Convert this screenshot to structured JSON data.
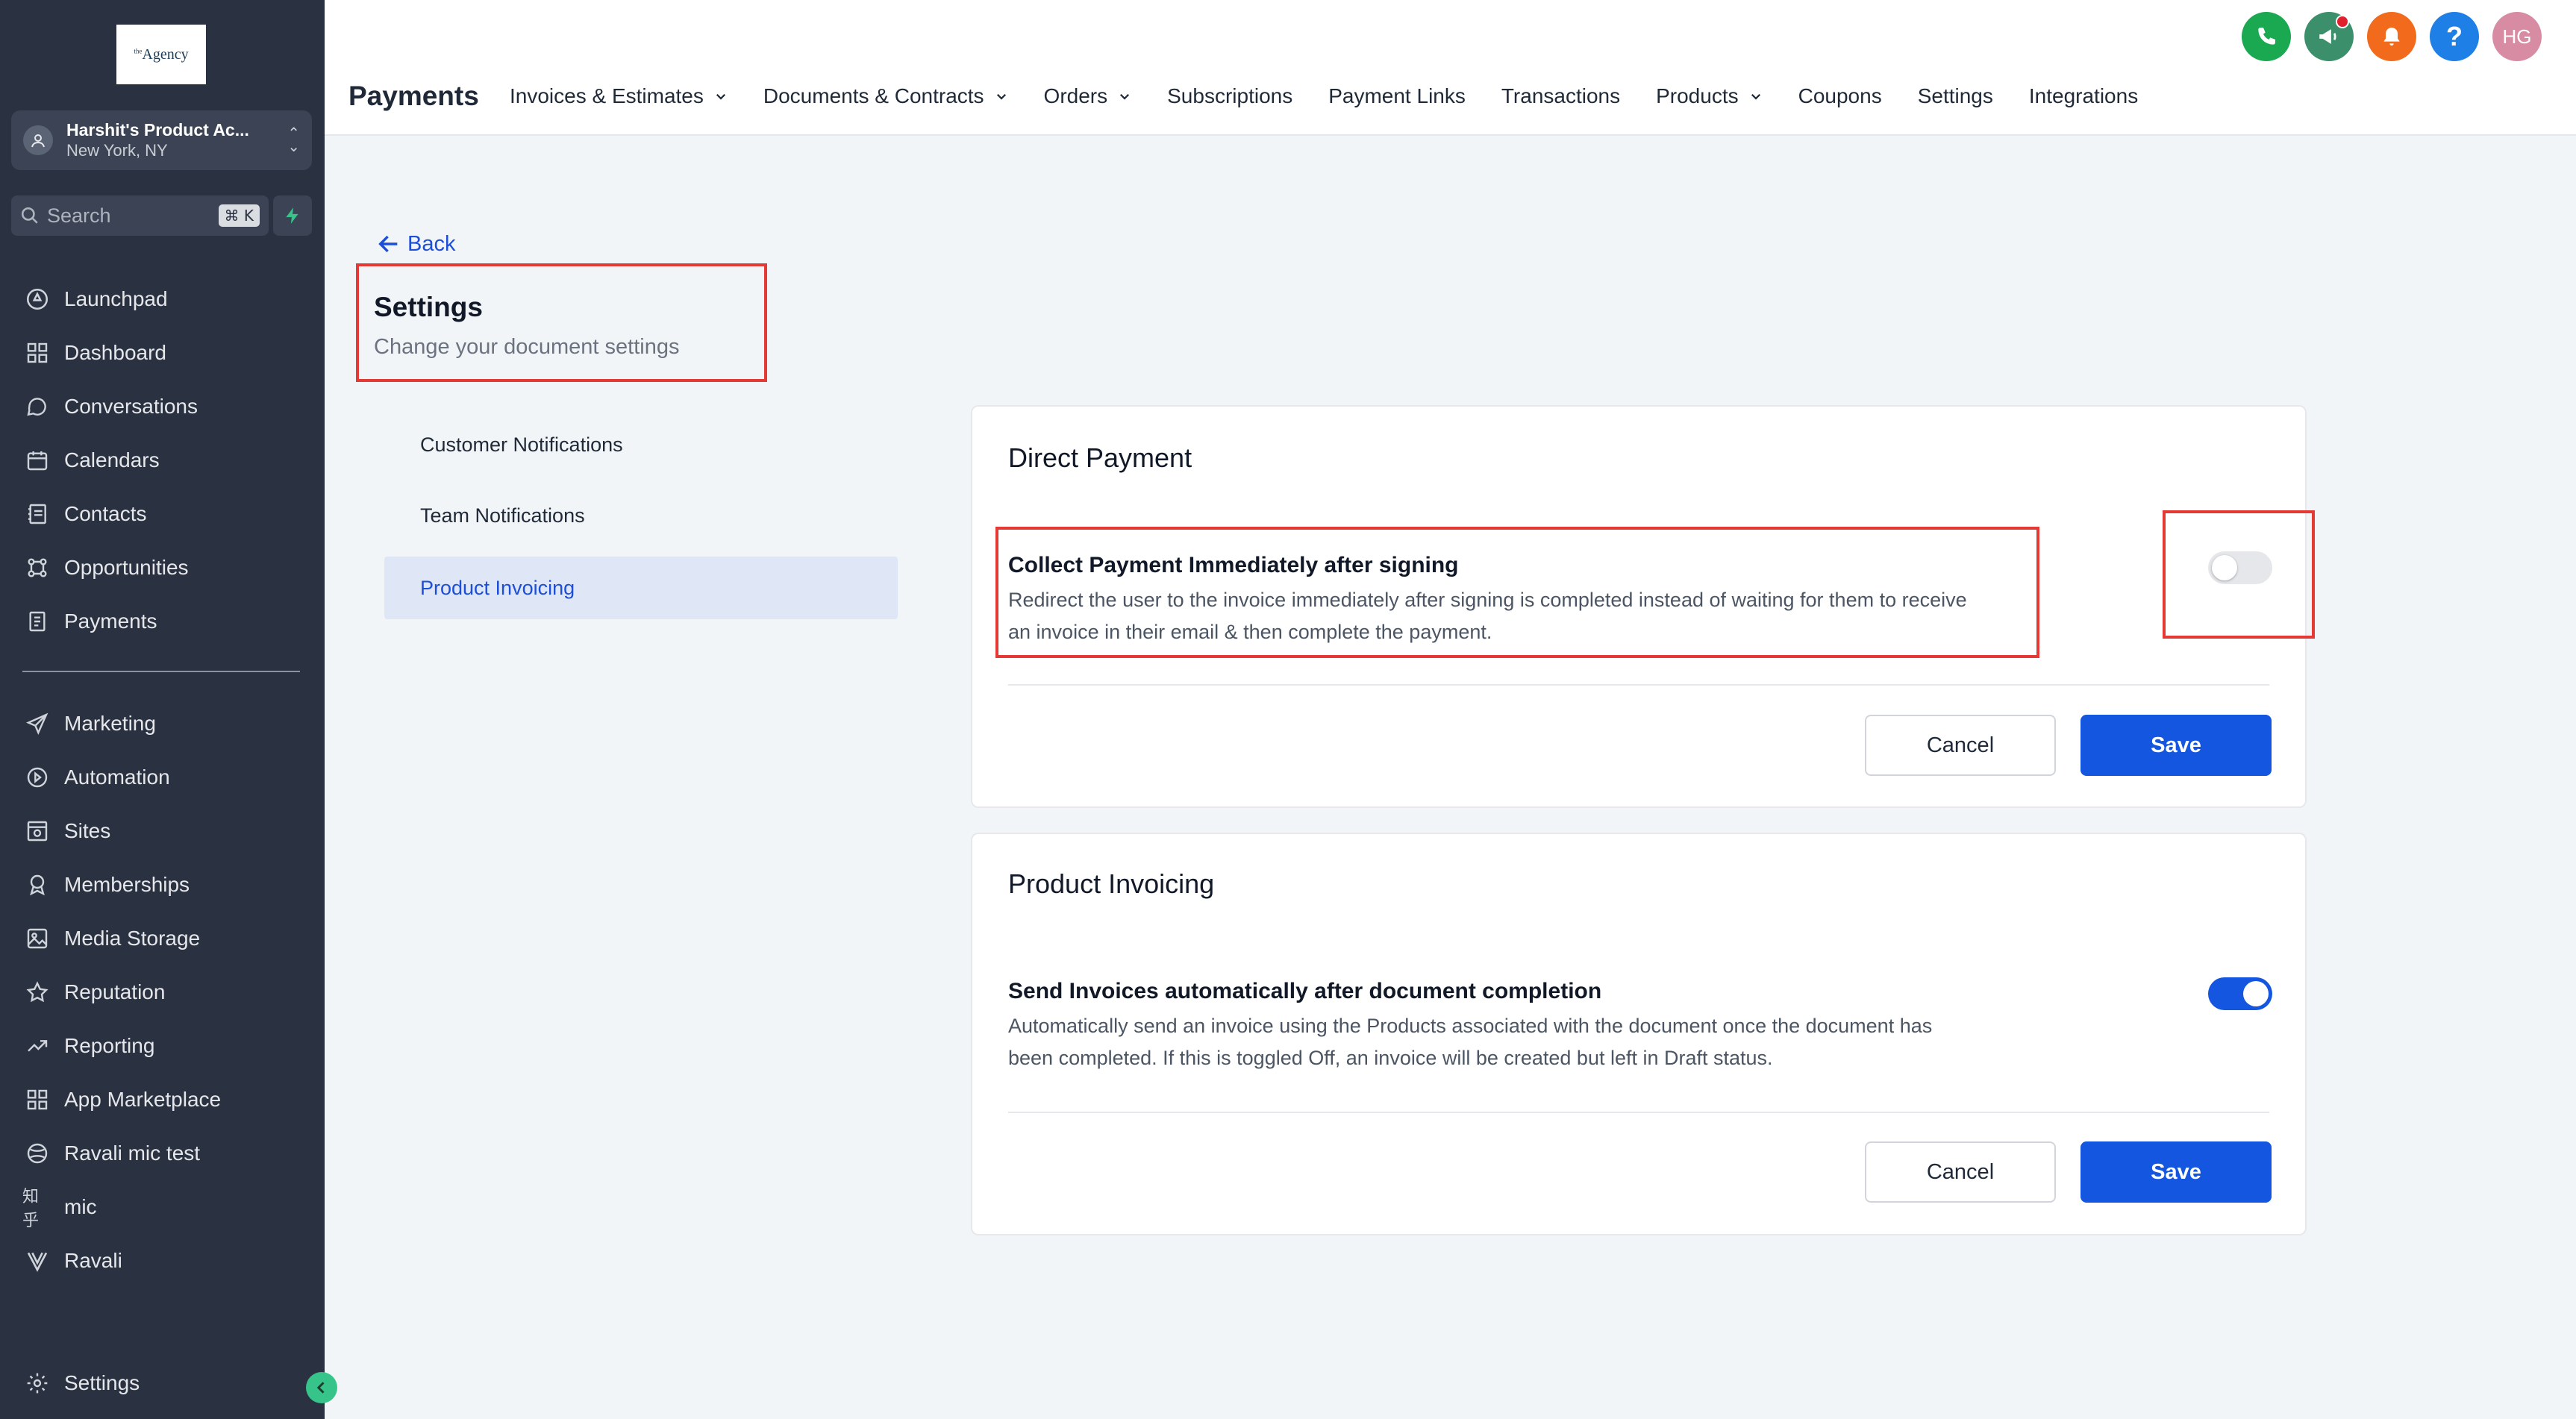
{
  "sidebar": {
    "logo_text": "Agency",
    "logo_sup": "the",
    "account_name": "Harshit's Product Ac...",
    "account_location": "New York, NY",
    "search_placeholder": "Search",
    "search_shortcut": "⌘ K",
    "items": [
      {
        "label": "Launchpad",
        "icon": "rocket-icon"
      },
      {
        "label": "Dashboard",
        "icon": "dashboard-grid-icon"
      },
      {
        "label": "Conversations",
        "icon": "chat-bubble-icon"
      },
      {
        "label": "Calendars",
        "icon": "calendar-icon"
      },
      {
        "label": "Contacts",
        "icon": "contacts-icon"
      },
      {
        "label": "Opportunities",
        "icon": "opportunities-icon"
      },
      {
        "label": "Payments",
        "icon": "payments-icon"
      },
      {
        "label": "Marketing",
        "icon": "paper-plane-icon"
      },
      {
        "label": "Automation",
        "icon": "automation-icon"
      },
      {
        "label": "Sites",
        "icon": "sites-icon"
      },
      {
        "label": "Memberships",
        "icon": "membership-badge-icon"
      },
      {
        "label": "Media Storage",
        "icon": "image-icon"
      },
      {
        "label": "Reputation",
        "icon": "star-icon"
      },
      {
        "label": "Reporting",
        "icon": "trend-line-icon"
      },
      {
        "label": "App Marketplace",
        "icon": "app-grid-icon"
      },
      {
        "label": "Ravali mic test",
        "icon": "globe-icon"
      },
      {
        "label": "mic",
        "icon": "zhihu-icon"
      },
      {
        "label": "Ravali",
        "icon": "v-logo-icon"
      }
    ],
    "settings_label": "Settings"
  },
  "header": {
    "title": "Payments",
    "tabs": [
      {
        "label": "Invoices & Estimates",
        "has_dropdown": true
      },
      {
        "label": "Documents & Contracts",
        "has_dropdown": true
      },
      {
        "label": "Orders",
        "has_dropdown": true
      },
      {
        "label": "Subscriptions",
        "has_dropdown": false
      },
      {
        "label": "Payment Links",
        "has_dropdown": false
      },
      {
        "label": "Transactions",
        "has_dropdown": false
      },
      {
        "label": "Products",
        "has_dropdown": true
      },
      {
        "label": "Coupons",
        "has_dropdown": false
      },
      {
        "label": "Settings",
        "has_dropdown": false
      },
      {
        "label": "Integrations",
        "has_dropdown": false
      }
    ],
    "avatar_initials": "HG",
    "colors": {
      "phone": "#1aa851",
      "megaphone": "#3b8f6b",
      "bell": "#f26b1d",
      "help": "#1e7fe6"
    }
  },
  "main": {
    "back_label": "Back",
    "settings_title": "Settings",
    "settings_subtitle": "Change your document settings",
    "menu": [
      {
        "label": "Customer Notifications",
        "active": false
      },
      {
        "label": "Team Notifications",
        "active": false
      },
      {
        "label": "Product Invoicing",
        "active": true
      }
    ],
    "cards": [
      {
        "title": "Direct Payment",
        "option_title": "Collect Payment Immediately after signing",
        "option_desc_1": "Redirect the user to the invoice immediately after signing is completed instead of waiting for them to receive",
        "option_desc_2": "an invoice in their email & then complete the payment.",
        "toggle_on": false,
        "cancel_label": "Cancel",
        "save_label": "Save"
      },
      {
        "title": "Product Invoicing",
        "option_title": "Send Invoices automatically after document completion",
        "option_desc_1": "Automatically send an invoice using the Products associated with the document once the document has",
        "option_desc_2": "been completed. If this is toggled Off, an invoice will be created but left in Draft status.",
        "toggle_on": true,
        "cancel_label": "Cancel",
        "save_label": "Save"
      }
    ]
  },
  "accent_color": "#1456e0",
  "highlight_color": "#e53935"
}
